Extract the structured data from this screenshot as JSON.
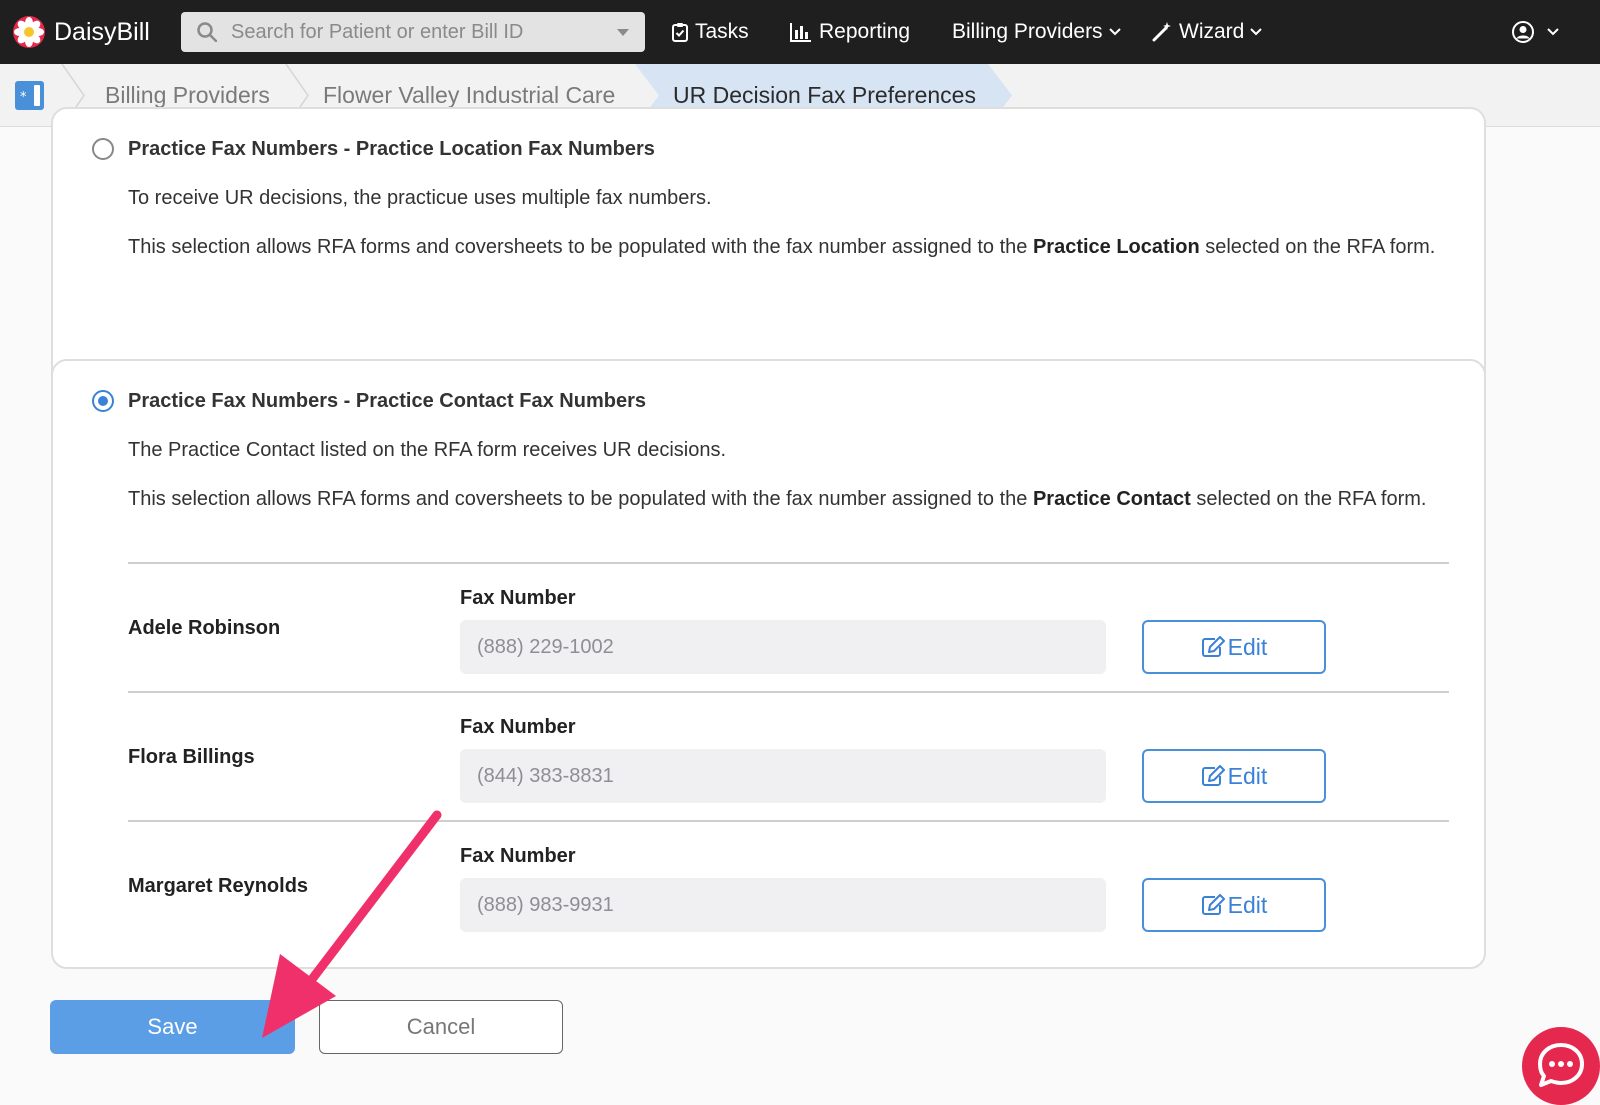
{
  "app": {
    "brand_name": "DaisyBill"
  },
  "navbar": {
    "search_placeholder": "Search for Patient or enter Bill ID",
    "tasks_label": "Tasks",
    "reporting_label": "Reporting",
    "billing_providers_label": "Billing Providers",
    "wizard_label": "Wizard"
  },
  "breadcrumb": {
    "items": [
      "Billing Providers",
      "Flower Valley Industrial Care"
    ],
    "active": "UR Decision Fax Preferences"
  },
  "options": [
    {
      "title": "Practice Fax Numbers - Practice Location Fax Numbers",
      "selected": false,
      "description": "To receive UR decisions, the practicue uses multiple fax numbers.",
      "detail_prefix": "This selection allows RFA forms and coversheets to be populated with the fax number assigned to the ",
      "detail_bold": "Practice Location",
      "detail_suffix": " selected on the RFA form."
    },
    {
      "title": "Practice Fax Numbers - Practice Contact Fax Numbers",
      "selected": true,
      "description": "The Practice Contact listed on the RFA form receives UR decisions.",
      "detail_prefix": "This selection allows RFA forms and coversheets to be populated with the fax number assigned to the ",
      "detail_bold": "Practice Contact",
      "detail_suffix": " selected on the RFA form."
    }
  ],
  "contacts": [
    {
      "name": "Adele Robinson",
      "fax_label": "Fax Number",
      "fax": "(888) 229-1002",
      "edit_label": "Edit"
    },
    {
      "name": "Flora Billings",
      "fax_label": "Fax Number",
      "fax": "(844) 383-8831",
      "edit_label": "Edit"
    },
    {
      "name": "Margaret Reynolds",
      "fax_label": "Fax Number",
      "fax": "(888) 983-9931",
      "edit_label": "Edit"
    }
  ],
  "actions": {
    "save_label": "Save",
    "cancel_label": "Cancel"
  },
  "colors": {
    "navbar_bg": "#1f1f1f",
    "accent_blue": "#3b82d6",
    "save_bg": "#5c9ee6",
    "annotation_arrow": "#f0306a",
    "chat_bg": "#e5284e",
    "breadcrumb_active_bg": "#d6e4f3"
  }
}
